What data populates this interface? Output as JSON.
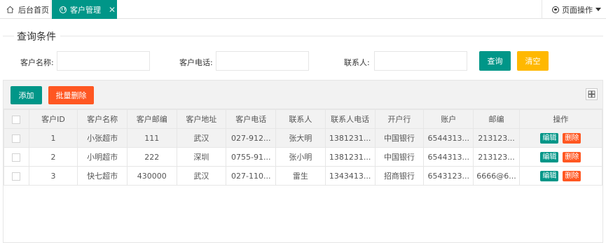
{
  "tabs": {
    "home_label": "后台首页",
    "active_label": "客户管理",
    "close_glyph": "✕",
    "page_ops_label": "页面操作"
  },
  "query": {
    "legend": "查询条件",
    "name_label": "客户名称:",
    "phone_label": "客户电话:",
    "contact_label": "联系人:",
    "name_value": "",
    "phone_value": "",
    "contact_value": "",
    "query_button": "查询",
    "clear_button": "清空"
  },
  "toolbar": {
    "add_button": "添加",
    "batch_delete_button": "批量删除"
  },
  "table": {
    "columns": [
      "客户ID",
      "客户名称",
      "客户邮编",
      "客户地址",
      "客户电话",
      "联系人",
      "联系人电话",
      "开户行",
      "账户",
      "邮编",
      "操作"
    ],
    "rows": [
      [
        "1",
        "小张超市",
        "111",
        "武汉",
        "027-912...",
        "张大明",
        "1381231...",
        "中国银行",
        "6544313...",
        "213123..."
      ],
      [
        "2",
        "小明超市",
        "222",
        "深圳",
        "0755-91...",
        "张小明",
        "1381231...",
        "中国银行",
        "6544313...",
        "213123..."
      ],
      [
        "3",
        "快七超市",
        "430000",
        "武汉",
        "027-110...",
        "雷生",
        "1343413...",
        "招商银行",
        "6543123...",
        "6666@6..."
      ]
    ],
    "edit_label": "编辑",
    "delete_label": "删除"
  },
  "colors": {
    "primary": "#009688",
    "danger": "#ff5722",
    "warn": "#ffb800"
  }
}
